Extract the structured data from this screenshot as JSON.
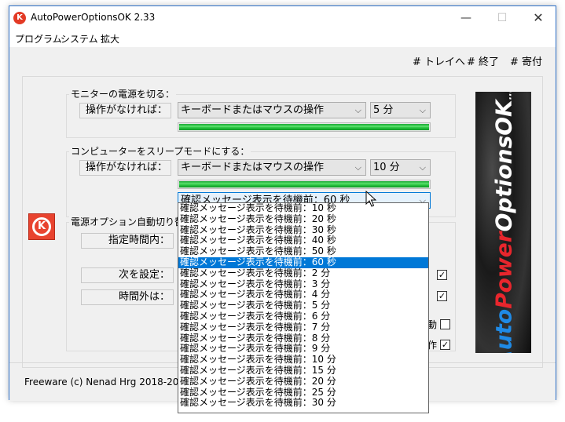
{
  "window": {
    "title": "AutoPowerOptionsOK 2.33",
    "icon_letter": "K"
  },
  "titlebar": {
    "minimize": "—",
    "maximize": "☐",
    "close": "✕"
  },
  "menu": [
    "プログラム",
    "システム",
    "拡大"
  ],
  "toplinks": [
    "# トレイへ",
    "# 終了",
    "# 寄付"
  ],
  "monitor_group": {
    "title": "モニターの電源を切る：",
    "label": "操作がなければ：",
    "condition": "キーボードまたはマウスの操作",
    "time": "5 分",
    "progress_percent": 100
  },
  "sleep_group": {
    "title": "コンピューターをスリープモードにする：",
    "label": "操作がなければ：",
    "condition": "キーボードまたはマウスの操作",
    "time": "10 分",
    "progress_percent": 100,
    "confirm_combo": "確認メッセージ表示を待機前：60 秒"
  },
  "power_group": {
    "title": "電源オプション自動切り替",
    "rows": [
      "指定時間内：",
      "次を設定：",
      "時間外は："
    ]
  },
  "side_labels": [
    "動",
    "作"
  ],
  "checkbox_states": [
    true,
    true,
    false,
    true
  ],
  "footer": "Freeware (c) Nenad Hrg 2018-20",
  "dropdown": {
    "items": [
      "確認メッセージ表示を待機前：10 秒",
      "確認メッセージ表示を待機前：20 秒",
      "確認メッセージ表示を待機前：30 秒",
      "確認メッセージ表示を待機前：40 秒",
      "確認メッセージ表示を待機前：50 秒",
      "確認メッセージ表示を待機前：60 秒",
      "確認メッセージ表示を待機前：2 分",
      "確認メッセージ表示を待機前：3 分",
      "確認メッセージ表示を待機前：4 分",
      "確認メッセージ表示を待機前：5 分",
      "確認メッセージ表示を待機前：6 分",
      "確認メッセージ表示を待機前：7 分",
      "確認メッセージ表示を待機前：8 分",
      "確認メッセージ表示を待機前：9 分",
      "確認メッセージ表示を待機前：10 分",
      "確認メッセージ表示を待機前：15 分",
      "確認メッセージ表示を待機前：20 分",
      "確認メッセージ表示を待機前：25 分",
      "確認メッセージ表示を待機前：30 分"
    ],
    "selected_index": 5
  },
  "banner": {
    "part1": "Auto",
    "part2": "Power",
    "part3": "OptionsOK",
    "dots": "......"
  },
  "colors": {
    "selection": "#0078d7",
    "progress": "#1fb83a",
    "logo_red": "#e8432f"
  }
}
